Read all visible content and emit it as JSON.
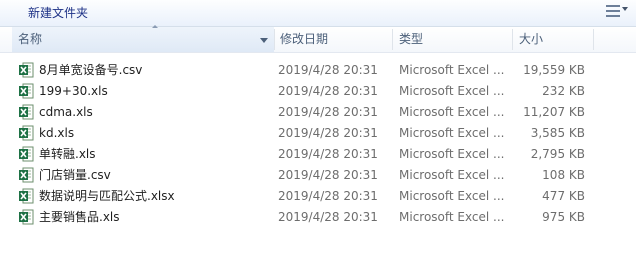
{
  "toolbar": {
    "new_folder_label": "新建文件夹"
  },
  "columns": {
    "name": "名称",
    "date": "修改日期",
    "type": "类型",
    "size": "大小"
  },
  "files": [
    {
      "name": "8月单宽设备号.csv",
      "date": "2019/4/28 20:31",
      "type": "Microsoft Excel ...",
      "size": "19,559 KB"
    },
    {
      "name": "199+30.xls",
      "date": "2019/4/28 20:31",
      "type": "Microsoft Excel ...",
      "size": "232 KB"
    },
    {
      "name": "cdma.xls",
      "date": "2019/4/28 20:31",
      "type": "Microsoft Excel ...",
      "size": "11,207 KB"
    },
    {
      "name": "kd.xls",
      "date": "2019/4/28 20:31",
      "type": "Microsoft Excel ...",
      "size": "3,585 KB"
    },
    {
      "name": "单转融.xls",
      "date": "2019/4/28 20:31",
      "type": "Microsoft Excel ...",
      "size": "2,795 KB"
    },
    {
      "name": "门店销量.csv",
      "date": "2019/4/28 20:31",
      "type": "Microsoft Excel ...",
      "size": "108 KB"
    },
    {
      "name": "数据说明与匹配公式.xlsx",
      "date": "2019/4/28 20:31",
      "type": "Microsoft Excel ...",
      "size": "477 KB"
    },
    {
      "name": "主要销售品.xls",
      "date": "2019/4/28 20:31",
      "type": "Microsoft Excel ...",
      "size": "975 KB"
    }
  ],
  "icons": {
    "file": "excel-file-icon",
    "view": "view-options-icon"
  },
  "colors": {
    "toolbar_text": "#1e3287",
    "header_text": "#4c607a",
    "meta_text": "#6d6d6d",
    "excel_green": "#1e7145"
  }
}
